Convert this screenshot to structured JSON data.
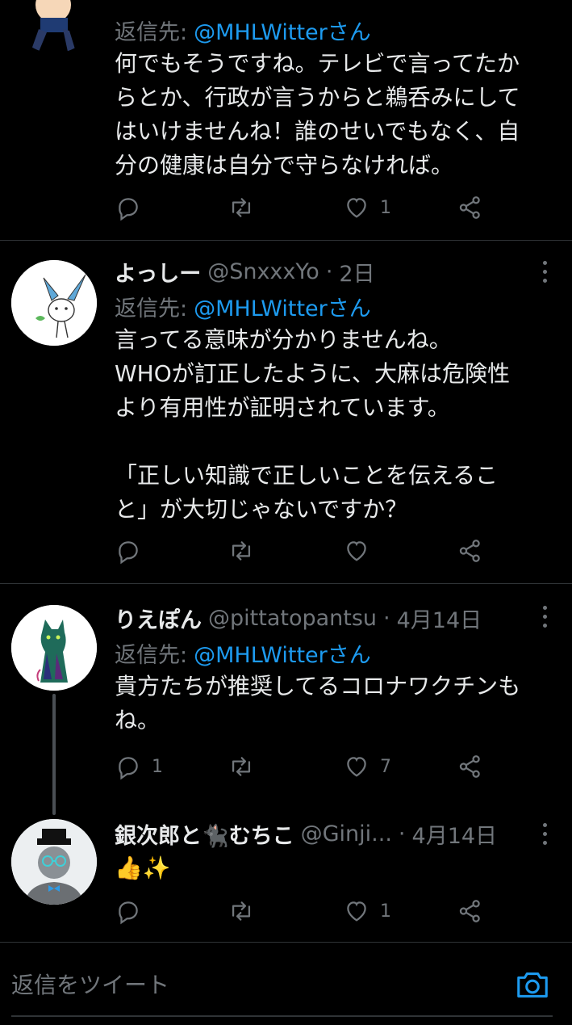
{
  "tweets": [
    {
      "reply_prefix": "返信先:",
      "reply_mention": "@MHLWitterさん",
      "text": "何でもそうですね。テレビで言ってたか\nらとか、行政が言うからと鵜呑みにして\nはいけませんね！誰のせいでもなく、自\n分の健康は自分で守らなければ。",
      "likes": "1"
    },
    {
      "name": "よっしー",
      "handle": "@SnxxxYo",
      "dot": "·",
      "time": "2日",
      "reply_prefix": "返信先:",
      "reply_mention": "@MHLWitterさん",
      "text": "言ってる意味が分かりませんね。\nWHOが訂正したように、大麻は危険性\nより有用性が証明されています。\n\n「正しい知識で正しいことを伝えるこ\nと」が大切じゃないですか？"
    },
    {
      "name": "りえぽん",
      "handle": "@pittatopantsu",
      "dot": "·",
      "time": "4月14日",
      "reply_prefix": "返信先:",
      "reply_mention": "@MHLWitterさん",
      "text": "貴方たちが推奨してるコロナワクチンも\nね。",
      "replies": "1",
      "likes": "7"
    },
    {
      "name": "銀次郎と🐈‍⬛むちこ",
      "handle": "@Ginji...",
      "dot": "·",
      "time": "4月14日",
      "text": "👍✨",
      "likes": "1"
    }
  ],
  "composer": {
    "placeholder": "返信をツイート"
  },
  "icons": {
    "reply": "reply-icon",
    "retweet": "retweet-icon",
    "like": "heart-icon",
    "share": "share-icon",
    "more": "more-icon",
    "camera": "camera-icon"
  },
  "colors": {
    "background": "#000000",
    "text": "#e7e9ea",
    "muted": "#71767b",
    "accent": "#1d9bf0",
    "divider": "#2f3336"
  }
}
